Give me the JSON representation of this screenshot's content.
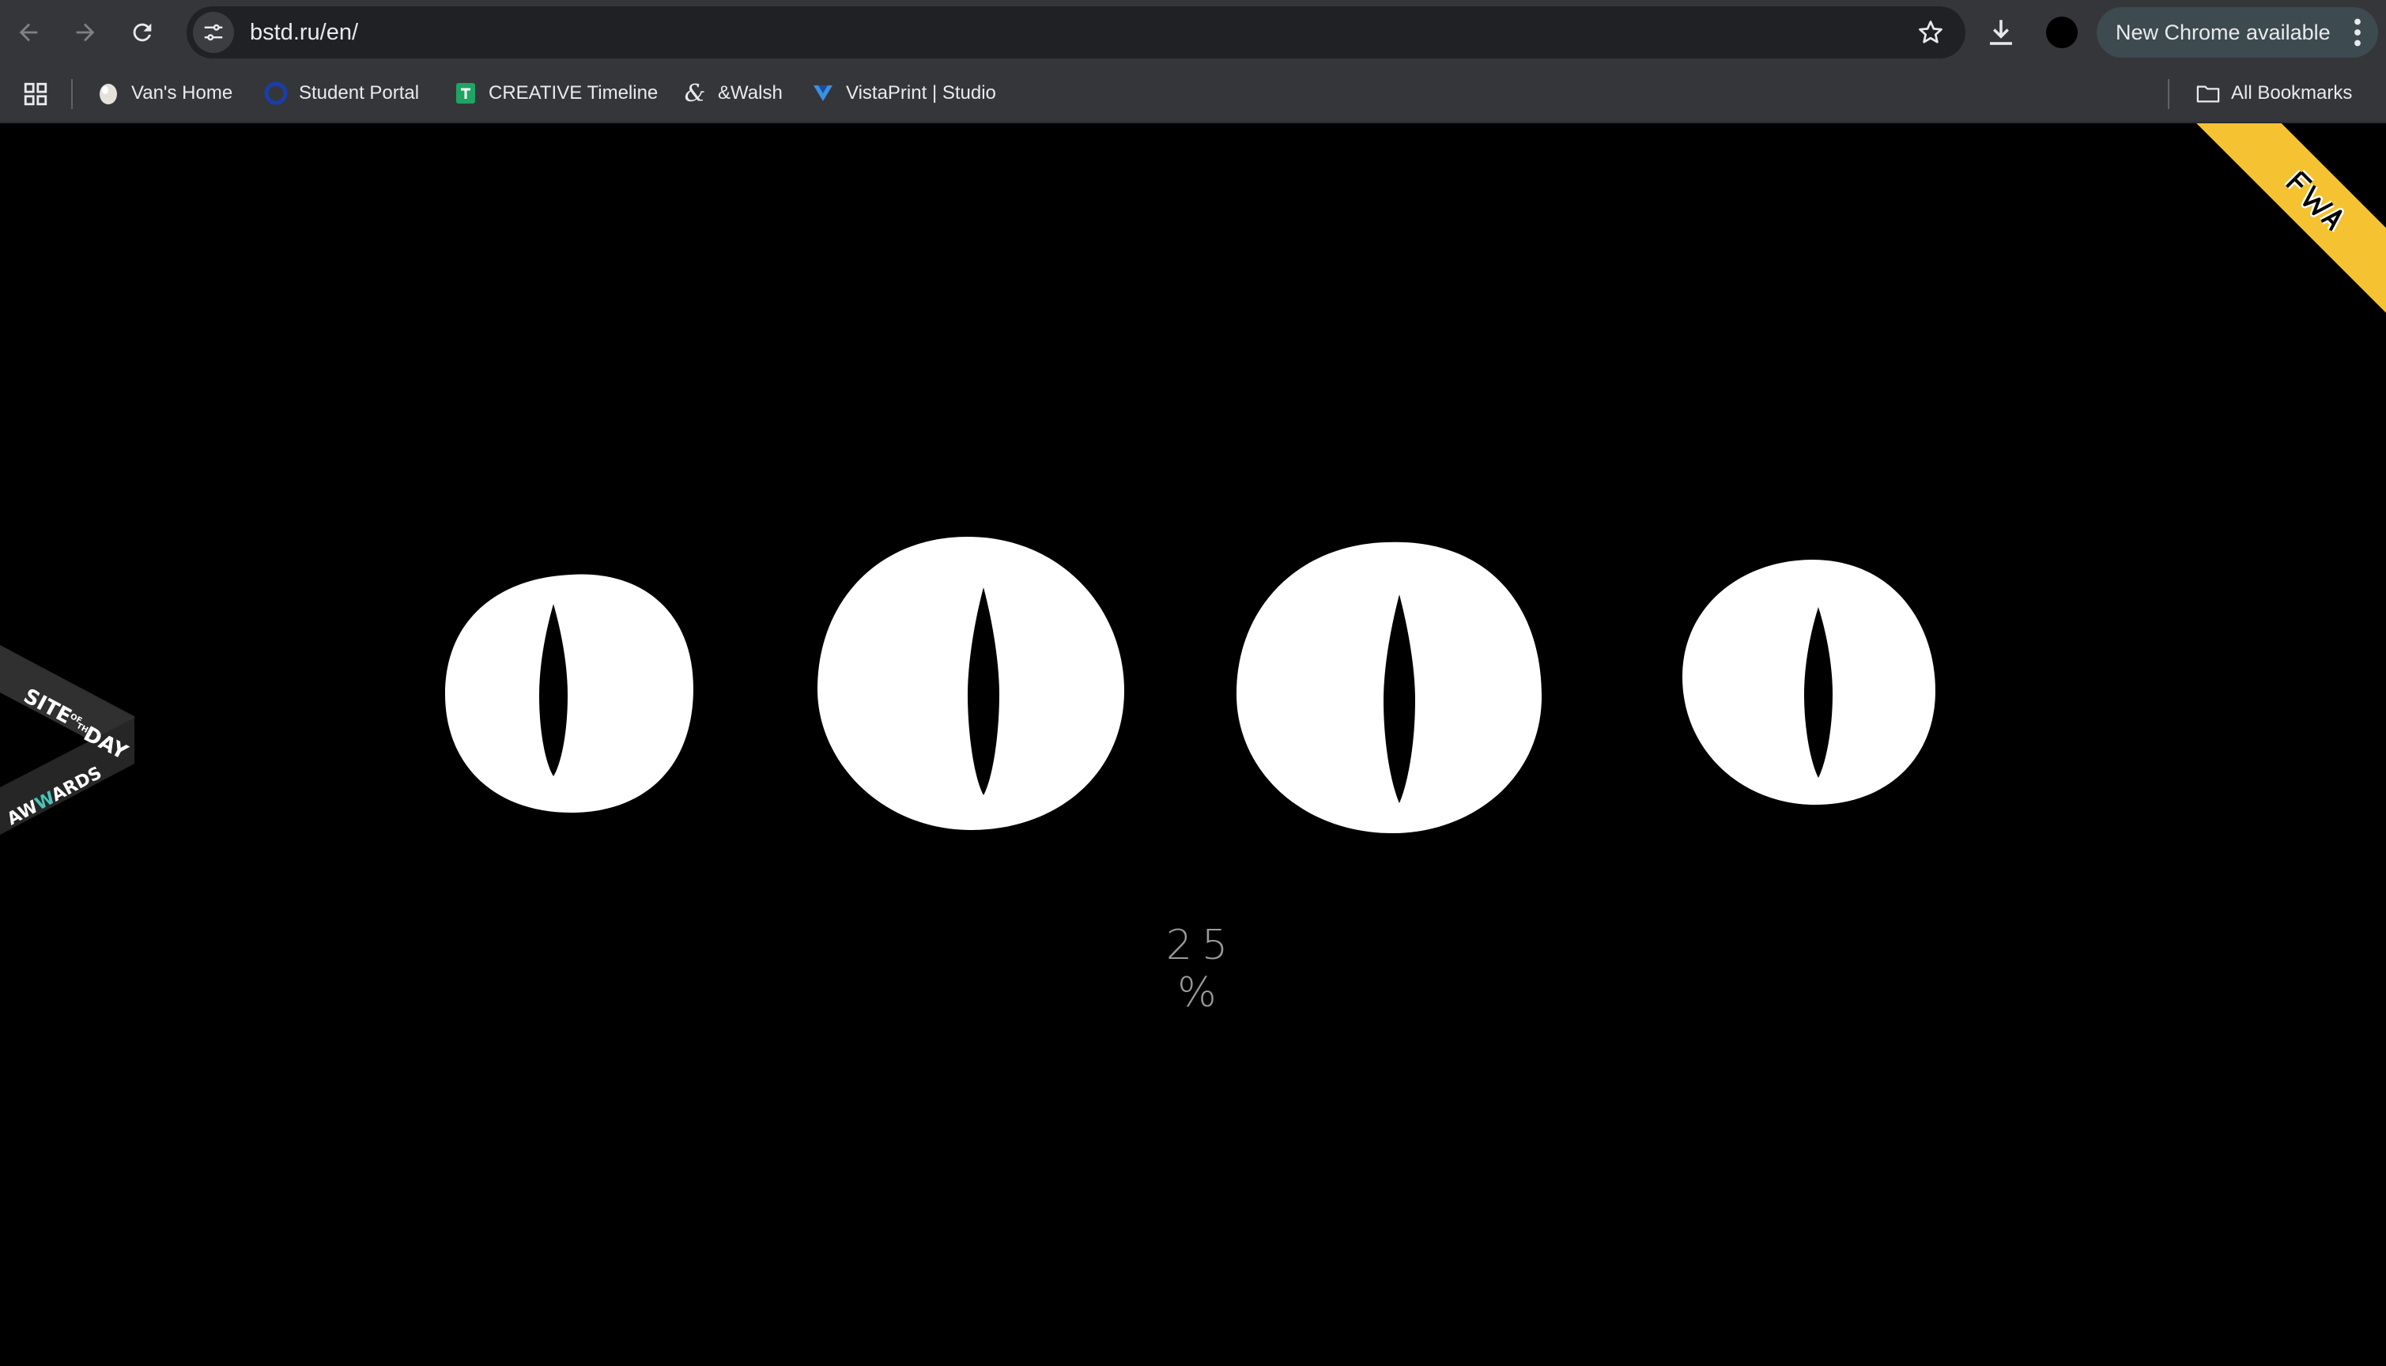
{
  "browser": {
    "url": "bstd.ru/en/",
    "new_chrome_label": "New Chrome available",
    "bookmarks": [
      {
        "label": "Van's Home",
        "icon": "egg-icon"
      },
      {
        "label": "Student Portal",
        "icon": "circle-logo-icon"
      },
      {
        "label": "CREATIVE Timeline",
        "icon": "google-sheets-icon"
      },
      {
        "label": "&Walsh",
        "icon": "ampersand-logo-icon"
      },
      {
        "label": "VistaPrint | Studio",
        "icon": "vistaprint-icon"
      }
    ],
    "all_bookmarks_label": "All Bookmarks"
  },
  "page": {
    "loader": {
      "percent_text": "25 %",
      "progress": 25
    },
    "badges": {
      "fwa": "FWA",
      "awwards_top": "SITE OF THE DAY",
      "awwards_bottom": "AWWARDS"
    }
  },
  "colors": {
    "chrome_bg": "#35363a",
    "omnibox_bg": "#202124",
    "page_bg": "#000000",
    "eye_white": "#ffffff",
    "fwa_yellow": "#f5c232"
  }
}
